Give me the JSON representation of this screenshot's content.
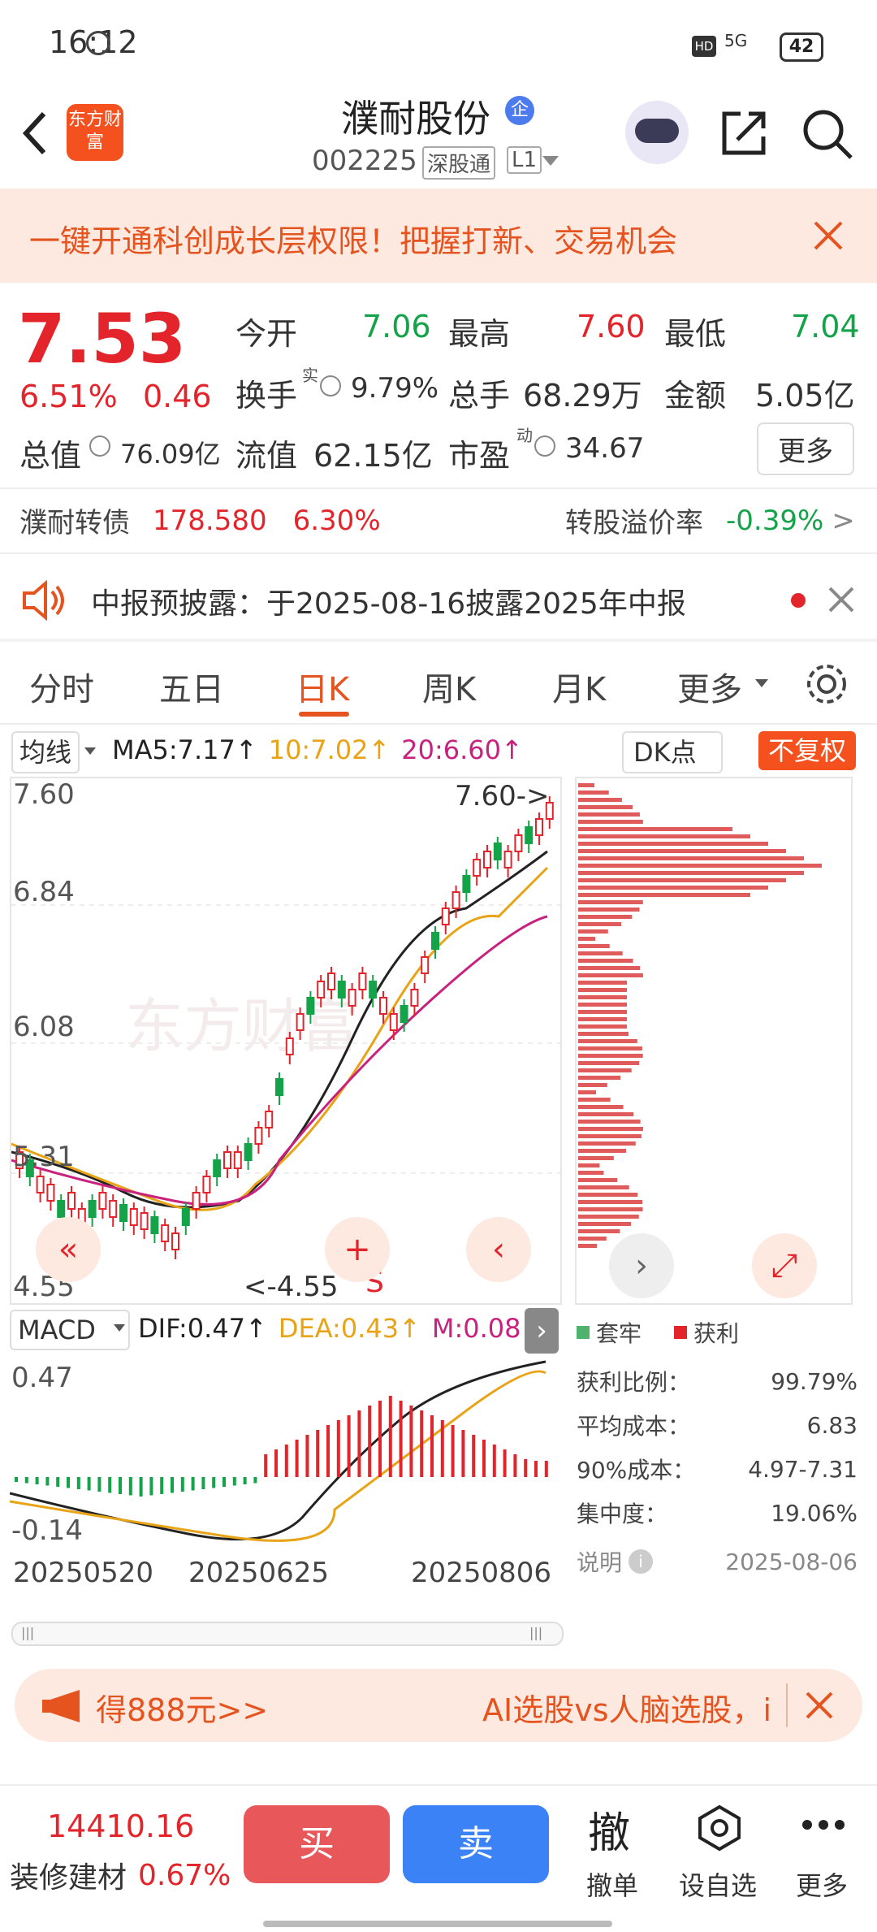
{
  "status_bar": {
    "time": "16:12",
    "battery": "42",
    "network": "5G"
  },
  "header": {
    "logo_text": "东方财富",
    "stock_name": "濮耐股份",
    "badge": "企",
    "code": "002225",
    "tag1": "深股通",
    "tag2": "L1"
  },
  "banner": {
    "text": "一键开通科创成长层权限！把握打新、交易机会"
  },
  "quote": {
    "price": "7.53",
    "change_pct": "6.51%",
    "change": "0.46",
    "open_label": "今开",
    "open": "7.06",
    "high_label": "最高",
    "high": "7.60",
    "low_label": "最低",
    "low": "7.04",
    "turnover_label": "换手",
    "turnover_sup": "实",
    "turnover": "9.79%",
    "volume_label": "总手",
    "volume": "68.29万",
    "amount_label": "金额",
    "amount": "5.05亿",
    "mktcap_label": "总值",
    "mktcap": "76.09亿",
    "float_label": "流值",
    "float": "62.15亿",
    "pe_label": "市盈",
    "pe_sup": "动",
    "pe": "34.67",
    "more": "更多"
  },
  "bond": {
    "name": "濮耐转债",
    "price": "178.580",
    "pct": "6.30%",
    "premium_label": "转股溢价率",
    "premium": "-0.39%"
  },
  "notice": {
    "text": "中报预披露：于2025-08-16披露2025年中报"
  },
  "tabs": [
    {
      "label": "分时"
    },
    {
      "label": "五日"
    },
    {
      "label": "日K"
    },
    {
      "label": "周K"
    },
    {
      "label": "月K"
    },
    {
      "label": "更多"
    }
  ],
  "ma": {
    "type": "均线",
    "ma5": "MA5:7.17↑",
    "ma10": "10:7.02↑",
    "ma20": "20:6.60↑",
    "dk": "DK点",
    "fq": "不复权"
  },
  "kline": {
    "y_labels": [
      "7.60",
      "6.84",
      "6.08",
      "5.31",
      "4.55"
    ],
    "high_marker": "7.60->",
    "low_marker": "<-4.55",
    "s_marker": "S"
  },
  "macd": {
    "label": "MACD",
    "dif": "DIF:0.47↑",
    "dea": "DEA:0.43↑",
    "m": "M:0.08↑",
    "y_top": "0.47",
    "y_bot": "-0.14"
  },
  "dates": [
    "20250520",
    "20250625",
    "20250806"
  ],
  "chip": {
    "legend_loss": "套牢",
    "legend_gain": "获利",
    "rows": [
      {
        "label": "获利比例：",
        "value": "99.79%"
      },
      {
        "label": "平均成本：",
        "value": "6.83"
      },
      {
        "label": "90%成本：",
        "value": "4.97-7.31"
      },
      {
        "label": "集中度：",
        "value": "19.06%"
      }
    ],
    "explain": "说明",
    "date": "2025-08-06"
  },
  "promo": {
    "left": "得888元>>",
    "right": "AI选股vs人脑选股，i"
  },
  "bottom": {
    "index_value": "14410.16",
    "sector": "装修建材",
    "sector_pct": "0.67%",
    "buy": "买",
    "sell": "卖",
    "cancel_icon": "撤",
    "cancel": "撤单",
    "watch": "设自选",
    "more": "更多"
  },
  "chart_data": {
    "type": "candlestick",
    "ylim": [
      4.55,
      7.6
    ],
    "x_ticks": [
      "20250520",
      "20250625",
      "20250806"
    ],
    "series": [
      {
        "name": "MA5",
        "last": 7.17
      },
      {
        "name": "MA10",
        "last": 7.02
      },
      {
        "name": "MA20",
        "last": 6.6
      }
    ],
    "high": 7.6,
    "low": 4.55
  },
  "colors": {
    "up": "#e3242b",
    "down": "#15a34a",
    "accent": "#f5511e"
  }
}
